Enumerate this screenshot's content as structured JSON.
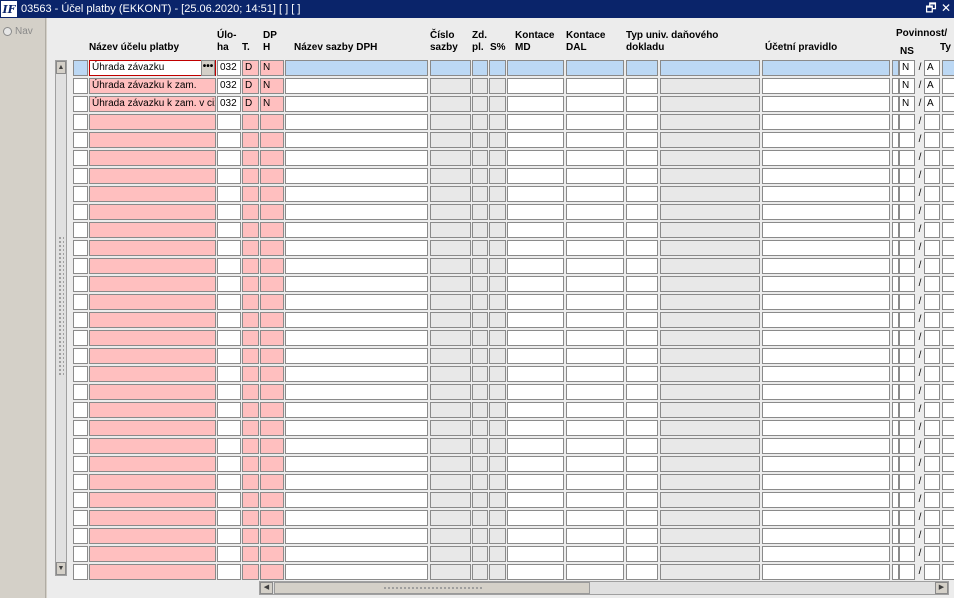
{
  "window": {
    "logo_text": "IF",
    "title": "03563 - Účel platby (EKKONT) - [25.06.2020; 14:51]  [ ]  [ ]",
    "restore_icon": "restore-icon",
    "close_icon": "close-icon",
    "restore_glyph": "🗗",
    "close_glyph": "✕"
  },
  "nav": {
    "label": "Nav"
  },
  "columns": {
    "nazev": "Název účelu platby",
    "uloha": "Úlo-\nha",
    "typ": "T.",
    "dph": "DP\nH",
    "nazev_sazby": "Název sazby DPH",
    "cislo_sazby": "Číslo\nsazby",
    "zd_pl": "Zd.\npl.",
    "s_pct": "S%",
    "kontace_md": "Kontace\nMD",
    "kontace_dal": "Kontace\nDAL",
    "typ_univ": "Typ univ. daňového\ndokladu",
    "ucetni_pravidlo": "Účetní pravidlo",
    "povinnost": "Povinnost/",
    "ns": "NS",
    "ty": "Ty"
  },
  "rows": [
    {
      "marker": "",
      "nazev": "Úhrada závazku",
      "uloha": "032",
      "typ": "D",
      "dph": "N",
      "ns": "N",
      "ty": "A",
      "lookup": "•••"
    },
    {
      "marker": "",
      "nazev": "Úhrada závazku k zam.",
      "uloha": "032",
      "typ": "D",
      "dph": "N",
      "ns": "N",
      "ty": "A"
    },
    {
      "marker": "*",
      "nazev": "Úhrada závazku k zam. v cizí měně",
      "uloha": "032",
      "typ": "D",
      "dph": "N",
      "ns": "N",
      "ty": "A"
    }
  ],
  "empty_row_count": 26,
  "separator": "/",
  "scroll": {
    "up": "▲",
    "down": "▼",
    "left": "◀",
    "right": "▶"
  }
}
